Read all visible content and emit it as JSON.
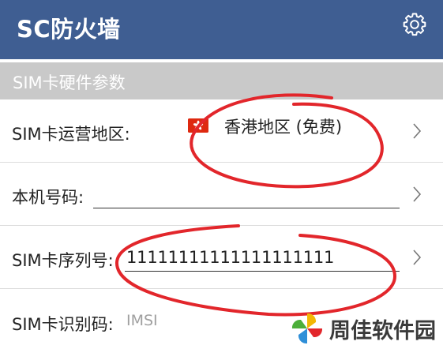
{
  "app": {
    "title": "SC防火墙",
    "settings_icon": "gear-icon"
  },
  "section": {
    "label": "SIM卡硬件参数"
  },
  "rows": [
    {
      "label": "SIM卡运营地区:",
      "value": "香港地区 (免费)",
      "icon": "hong-kong-flag-icon"
    },
    {
      "label": "本机号码:",
      "value": ""
    },
    {
      "label": "SIM卡序列号:",
      "value": "11111111111111111111"
    },
    {
      "label": "SIM卡识别码:",
      "placeholder": "IMSI"
    }
  ],
  "colors": {
    "appbar": "#3f5e92",
    "section": "#c9c9c9",
    "annotation": "#e2262b",
    "flag": "#de2910"
  },
  "watermark": {
    "text": "周佳软件园"
  }
}
